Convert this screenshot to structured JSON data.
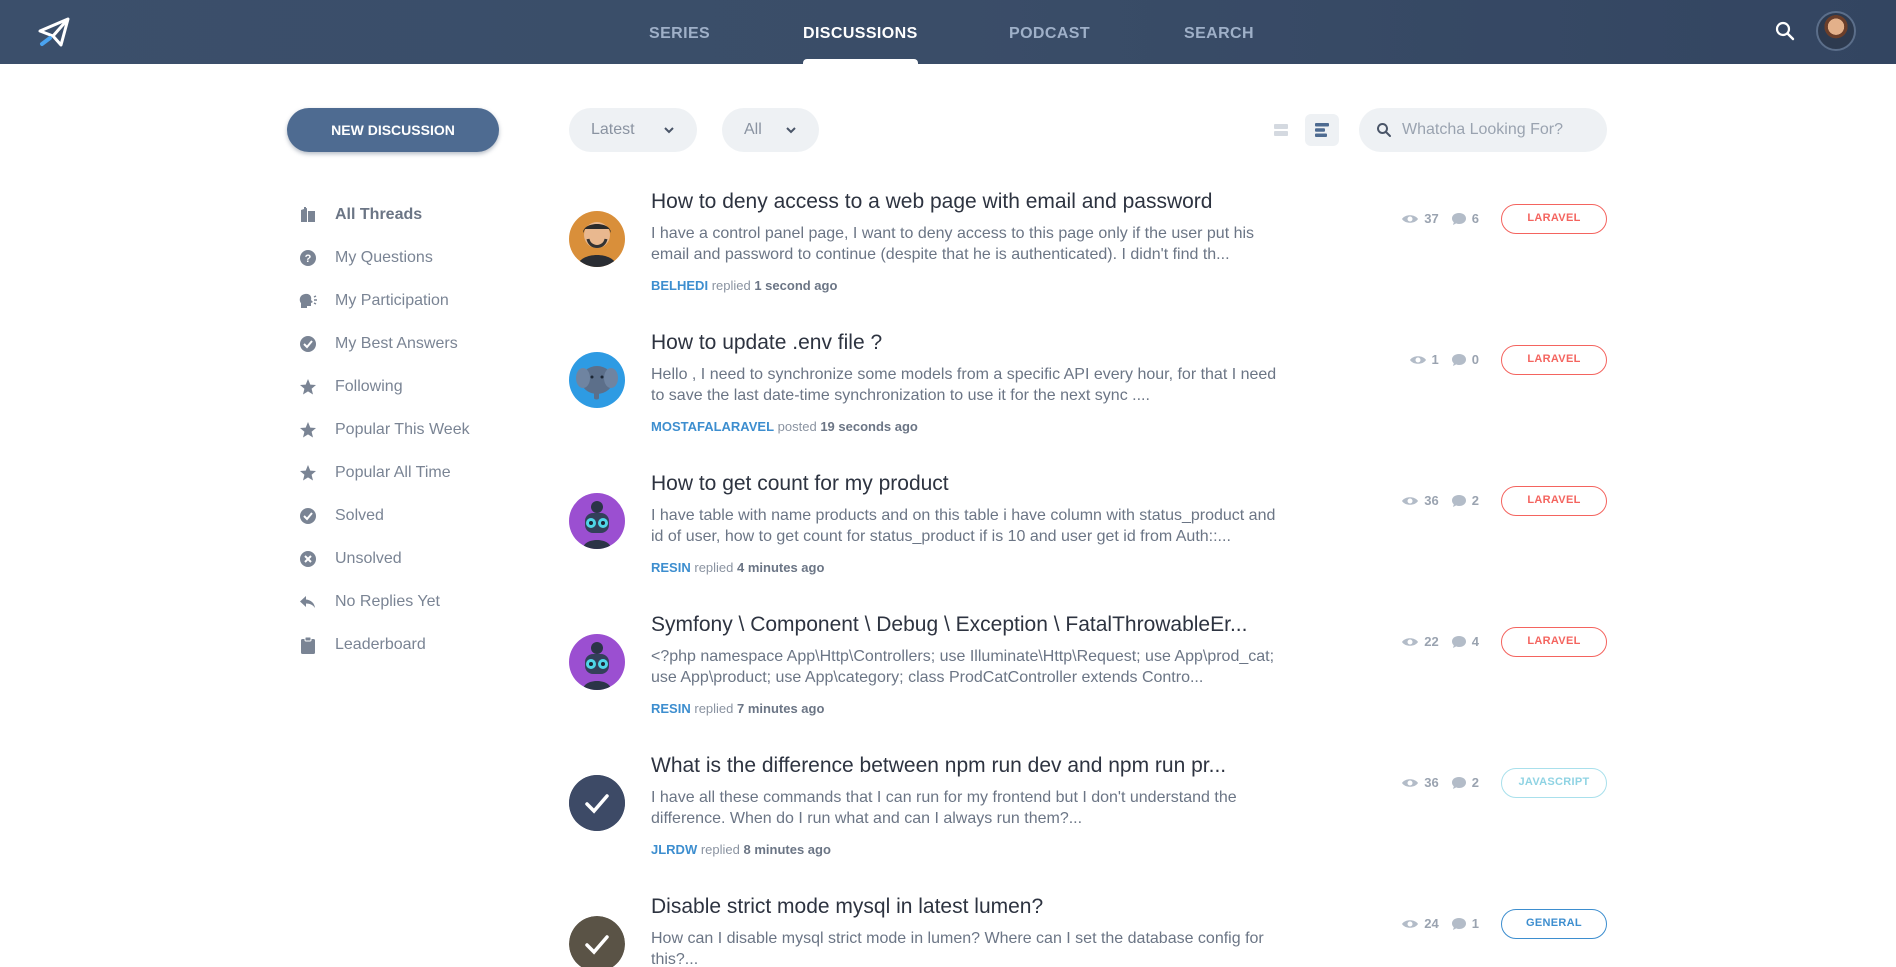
{
  "nav": {
    "items": [
      {
        "label": "SERIES",
        "active": false
      },
      {
        "label": "DISCUSSIONS",
        "active": true
      },
      {
        "label": "PODCAST",
        "active": false
      },
      {
        "label": "SEARCH",
        "active": false
      }
    ],
    "logo_icon": "paper-plane-icon",
    "search_icon": "search-icon"
  },
  "sidebar": {
    "new_button": "NEW DISCUSSION",
    "items": [
      {
        "label": "All Threads",
        "icon": "threads-icon",
        "active": true
      },
      {
        "label": "My Questions",
        "icon": "question-circle-icon"
      },
      {
        "label": "My Participation",
        "icon": "speaking-head-icon"
      },
      {
        "label": "My Best Answers",
        "icon": "check-circle-icon"
      },
      {
        "label": "Following",
        "icon": "star-icon"
      },
      {
        "label": "Popular This Week",
        "icon": "star-icon"
      },
      {
        "label": "Popular All Time",
        "icon": "star-icon"
      },
      {
        "label": "Solved",
        "icon": "check-circle-icon"
      },
      {
        "label": "Unsolved",
        "icon": "x-circle-icon"
      },
      {
        "label": "No Replies Yet",
        "icon": "reply-icon"
      },
      {
        "label": "Leaderboard",
        "icon": "clipboard-icon"
      }
    ]
  },
  "filters": {
    "sort": "Latest",
    "category": "All",
    "search_placeholder": "Whatcha Looking For?"
  },
  "colors": {
    "nav_bg": "#3b4f6b",
    "accent_blue": "#3d8ecf",
    "laravel_tag": "#f4645f",
    "javascript_tag": "#9fdce8",
    "general_tag": "#3d8ecf"
  },
  "threads": [
    {
      "title": "How to deny access to a web page with email and password",
      "excerpt": "I have a control panel page, I want to deny access to this page only if the user put his email and password to continue (despite that he is authenticated). I didn't find th...",
      "user": "BELHEDI",
      "action": "replied",
      "time": "1 second ago",
      "views": "37",
      "replies": "6",
      "tag": "LARAVEL",
      "avatar": "person-avatar"
    },
    {
      "title": "How to update .env file ?",
      "excerpt": "Hello , I need to synchronize some models from a specific API every hour, for that I need to save the last date-time synchronization to use it for the next sync ....",
      "user": "MOSTAFALARAVEL",
      "action": "posted",
      "time": "19 seconds ago",
      "views": "1",
      "replies": "0",
      "tag": "LARAVEL",
      "avatar": "elephant-avatar"
    },
    {
      "title": "How to get count for my product",
      "excerpt": "I have table with name products and on this table i have column with status_product and id of user, how to get count for status_product if is 10 and user get id from Auth::...",
      "user": "RESIN",
      "action": "replied",
      "time": "4 minutes ago",
      "views": "36",
      "replies": "2",
      "tag": "LARAVEL",
      "avatar": "robot-avatar"
    },
    {
      "title": "Symfony \\ Component \\ Debug \\ Exception \\ FatalThrowableEr...",
      "excerpt": "<?php namespace App\\Http\\Controllers; use Illuminate\\Http\\Request; use App\\prod_cat; use App\\product; use App\\category; class ProdCatController extends Contro...",
      "user": "RESIN",
      "action": "replied",
      "time": "7 minutes ago",
      "views": "22",
      "replies": "4",
      "tag": "LARAVEL",
      "avatar": "robot-avatar"
    },
    {
      "title": "What is the difference between npm run dev and npm run pr...",
      "excerpt": "I have all these commands that I can run for my frontend but I don't understand the difference. When do I run what and can I always run them?...",
      "user": "JLRDW",
      "action": "replied",
      "time": "8 minutes ago",
      "views": "36",
      "replies": "2",
      "tag": "JAVASCRIPT",
      "avatar": "solved-check-avatar"
    },
    {
      "title": "Disable strict mode mysql in latest lumen?",
      "excerpt": "How can I disable mysql strict mode in lumen? Where can I set the database config for this?...",
      "user": "",
      "action": "",
      "time": "",
      "views": "24",
      "replies": "1",
      "tag": "GENERAL",
      "avatar": "solved-check-avatar"
    }
  ]
}
